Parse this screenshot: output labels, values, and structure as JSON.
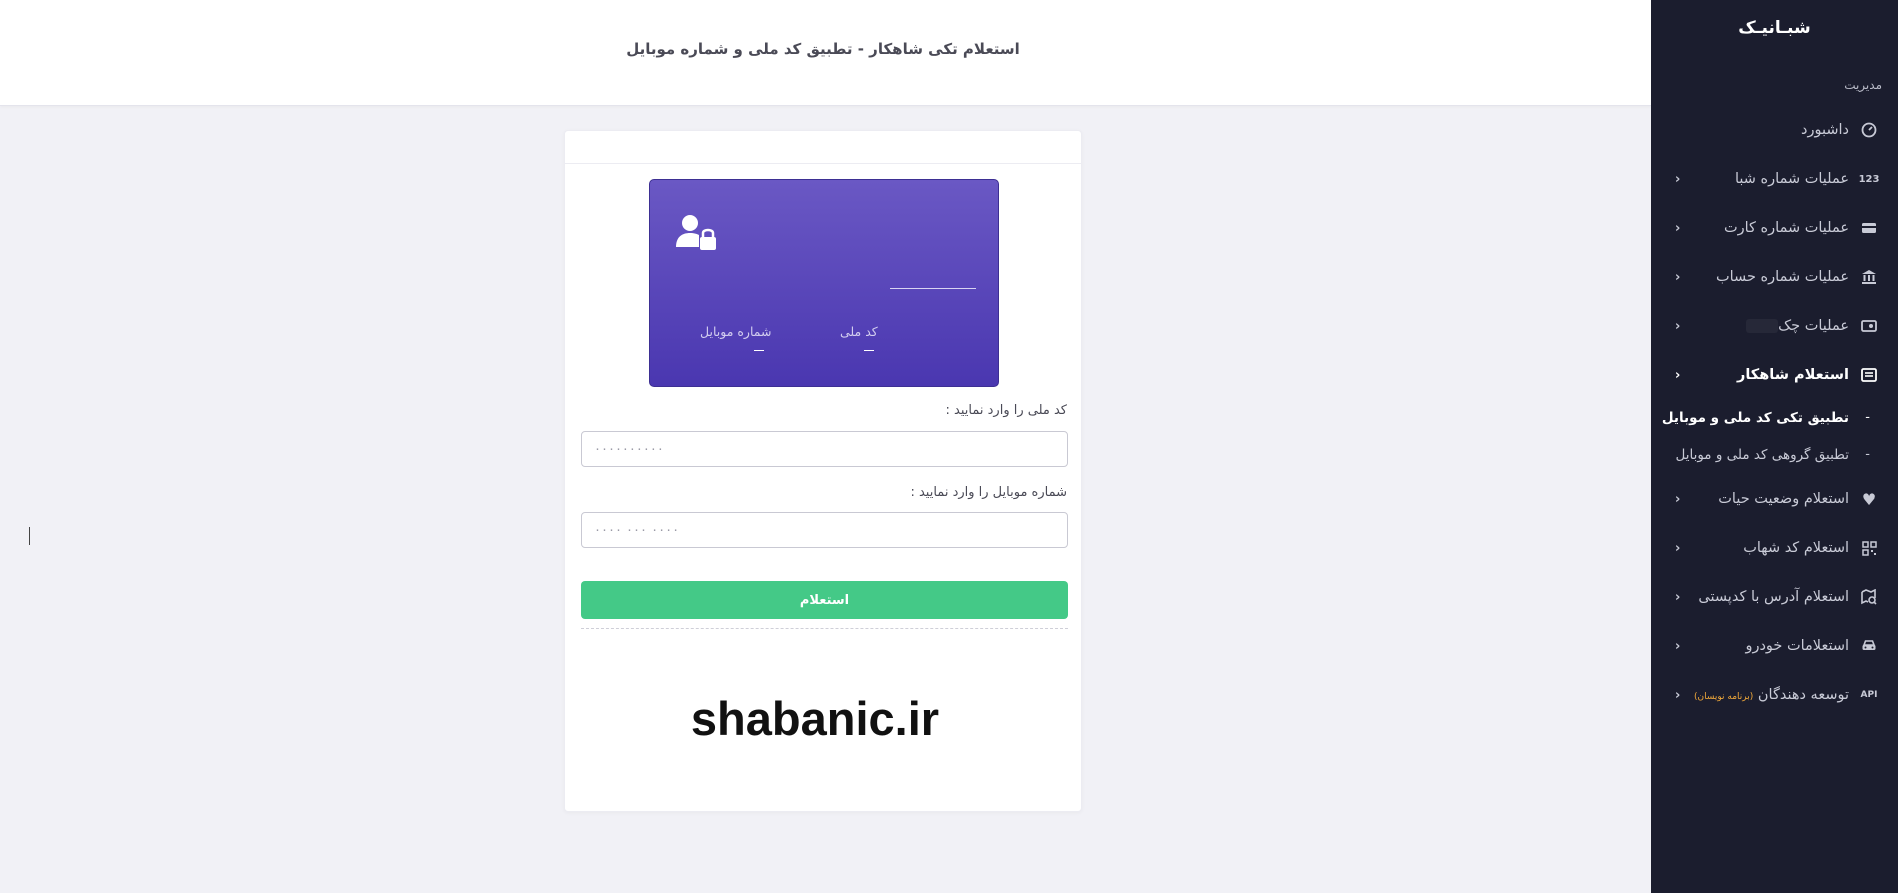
{
  "sidebar": {
    "brand": "شبـانیـک",
    "section_title": "مدیریت",
    "items": [
      {
        "label": "داشبورد",
        "icon": "gauge-icon",
        "has_chevron": false
      },
      {
        "label": "عملیات شماره شبا",
        "icon": "123-icon",
        "icon_text": "123",
        "has_chevron": true
      },
      {
        "label": "عملیات شماره کارت",
        "icon": "credit-card-icon",
        "has_chevron": true
      },
      {
        "label": "عملیات شماره حساب",
        "icon": "bank-icon",
        "has_chevron": true
      },
      {
        "label": "عملیات چک",
        "icon": "cheque-icon",
        "has_chevron": true
      },
      {
        "label": "استعلام شاهکار",
        "icon": "list-icon",
        "has_chevron": true,
        "active": true
      },
      {
        "label": "استعلام وضعیت حیات",
        "icon": "heart-icon",
        "has_chevron": true
      },
      {
        "label": "استعلام کد شهاب",
        "icon": "qr-icon",
        "has_chevron": true
      },
      {
        "label": "استعلام آدرس با کدپستی",
        "icon": "map-search-icon",
        "has_chevron": true
      },
      {
        "label": "استعلامات خودرو",
        "icon": "car-icon",
        "has_chevron": true
      },
      {
        "label": "توسعه دهندگان",
        "badge": "(برنامه نویسان)",
        "icon": "api-icon",
        "icon_text": "API",
        "has_chevron": true
      }
    ],
    "subitems": [
      {
        "label": "تطبیق تکی کد ملی و موبایل",
        "active": true
      },
      {
        "label": "تطبیق گروهی کد ملی و موبایل",
        "active": false
      }
    ]
  },
  "header": {
    "title": "استعلام تکی شاهکار - تطبیق کد ملی و شماره موبایل"
  },
  "card": {
    "icon": "user-lock-icon",
    "field_national_code": "کد ملی",
    "field_mobile": "شماره موبایل"
  },
  "form": {
    "national_code_label": "کد ملی را وارد نمایید :",
    "national_code_placeholder": "۰۰۰۰۰۰۰۰۰۰",
    "national_code_value": "",
    "mobile_label": "شماره موبایل را وارد نمایید :",
    "mobile_placeholder": "۰۰۰۰ ۰۰۰ ۰۰۰۰",
    "mobile_value": "",
    "submit_label": "استعلام"
  },
  "watermark": "shabanic.ir",
  "colors": {
    "sidebar_bg": "#1b1d2e",
    "card_gradient_top": "#6a58c4",
    "card_gradient_bottom": "#4a37b0",
    "submit_green": "#44c987",
    "badge_orange": "#f0a83a"
  }
}
